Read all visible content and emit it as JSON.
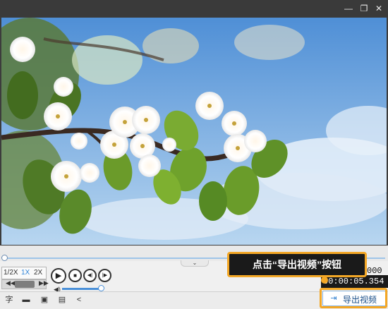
{
  "window": {
    "minimize_icon": "minimize-icon",
    "restore_icon": "restore-icon",
    "close_icon": "close-icon",
    "minimize_glyph": "—",
    "restore_glyph": "❐",
    "close_glyph": "✕"
  },
  "video": {
    "sky_top": "#4f8fd6",
    "sky_bottom": "#b8d6f0"
  },
  "playback": {
    "speed_options": [
      "1/2X",
      "1X",
      "2X"
    ],
    "speed_selected": "1X",
    "time_total": "000",
    "time_current": "00:00:05.354",
    "play_glyph": "▶",
    "stop_glyph": "■",
    "prev_glyph": "◀|",
    "next_glyph": "|▶",
    "frame_prev_glyph": "◀◀",
    "frame_next_glyph": "▶▶",
    "volume_glyph": "◀)",
    "collapse_glyph": "⌄"
  },
  "toolbar": {
    "icons": [
      "subtitle-icon",
      "folder-icon",
      "save-icon",
      "save-as-icon",
      "share-icon"
    ],
    "subtitle_glyph": "字",
    "folder_glyph": "▬",
    "save_glyph": "▣",
    "save_as_glyph": "▤",
    "share_glyph": "<",
    "export_label": "导出视频",
    "export_icon": "export-icon",
    "export_glyph": "⇥"
  },
  "callout": {
    "text": "点击“导出视频”按钮",
    "accent": "#f3a726"
  }
}
